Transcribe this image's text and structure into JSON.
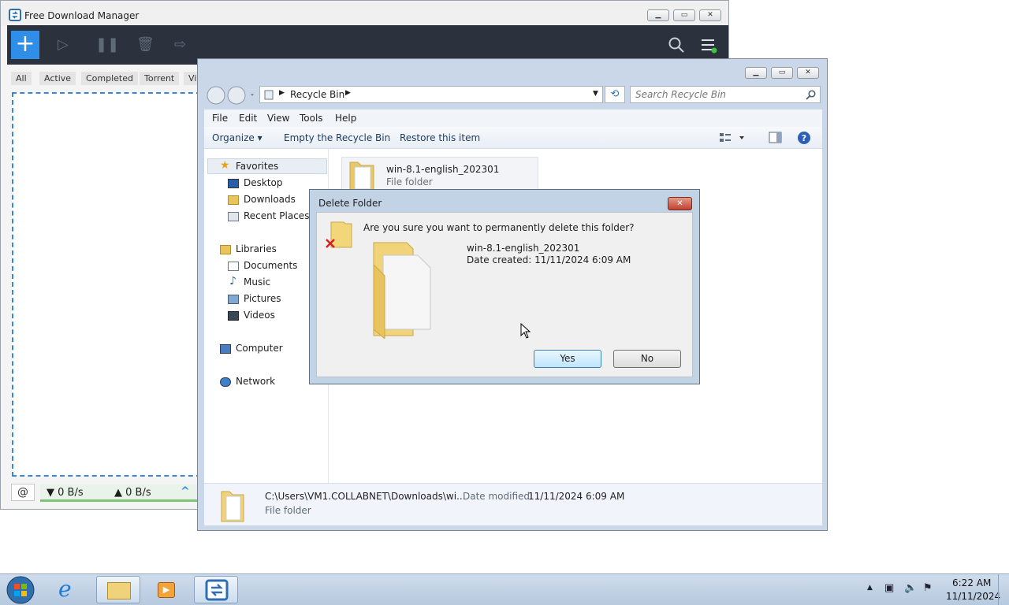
{
  "fdm": {
    "title": "Free Download Manager",
    "add_symbol": "+",
    "tabs": [
      "All",
      "Active",
      "Completed",
      "Torrent",
      "Vid"
    ],
    "download_speed": "▼ 0 B/s",
    "upload_speed": "▲ 0 B/s",
    "collapse_symbol": "^",
    "accent_color": "#2e8ee8"
  },
  "explorer": {
    "breadcrumb": "Recycle Bin",
    "search_placeholder": "Search Recycle Bin",
    "menu": [
      "File",
      "Edit",
      "View",
      "Tools",
      "Help"
    ],
    "commands": {
      "organize": "Organize ▾",
      "empty": "Empty the Recycle Bin",
      "restore": "Restore this item"
    },
    "nav": {
      "favorites": "Favorites",
      "desktop": "Desktop",
      "downloads": "Downloads",
      "recent": "Recent Places",
      "libraries": "Libraries",
      "documents": "Documents",
      "music": "Music",
      "pictures": "Pictures",
      "videos": "Videos",
      "computer": "Computer",
      "network": "Network"
    },
    "item": {
      "name": "win-8.1-english_202301",
      "type": "File folder"
    },
    "details": {
      "path": "C:\\Users\\VM1.COLLABNET\\Downloads\\wi...",
      "modified_label": "Date modified:",
      "modified_value": "11/11/2024 6:09 AM",
      "type": "File folder"
    }
  },
  "dialog": {
    "title": "Delete Folder",
    "question": "Are you sure you want to permanently delete this folder?",
    "folder_name": "win-8.1-english_202301",
    "date_created": "Date created: 11/11/2024 6:09 AM",
    "yes_label": "Yes",
    "no_label": "No"
  },
  "taskbar": {
    "time": "6:22 AM",
    "date": "11/11/2024"
  }
}
